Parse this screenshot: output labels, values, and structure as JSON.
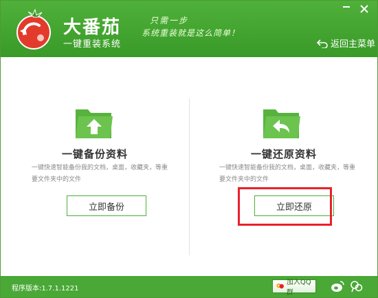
{
  "header": {
    "app_name": "大番茄",
    "app_subtitle": "一键重装系统",
    "slogan_line1": "只需一步",
    "slogan_line2": "系统重装就是这么简单！",
    "back_label": "返回主菜单"
  },
  "panels": [
    {
      "title": "一键备份资料",
      "description": "一键快速智能备份我的文档，桌面，收藏夹，等重要文件夹中的文件",
      "button_label": "立即备份",
      "icon": "folder-upload-icon"
    },
    {
      "title": "一键还原资料",
      "description": "一键快速智能备份我的文档，桌面，收藏夹，等重要文件夹中的文件",
      "button_label": "立即还原",
      "icon": "folder-restore-icon"
    }
  ],
  "footer": {
    "version": "程序版本:1.7.1.1221",
    "qq_group_label": "加入QQ群"
  },
  "colors": {
    "brand_green": "#4aa836",
    "highlight_red": "#e8202a"
  }
}
